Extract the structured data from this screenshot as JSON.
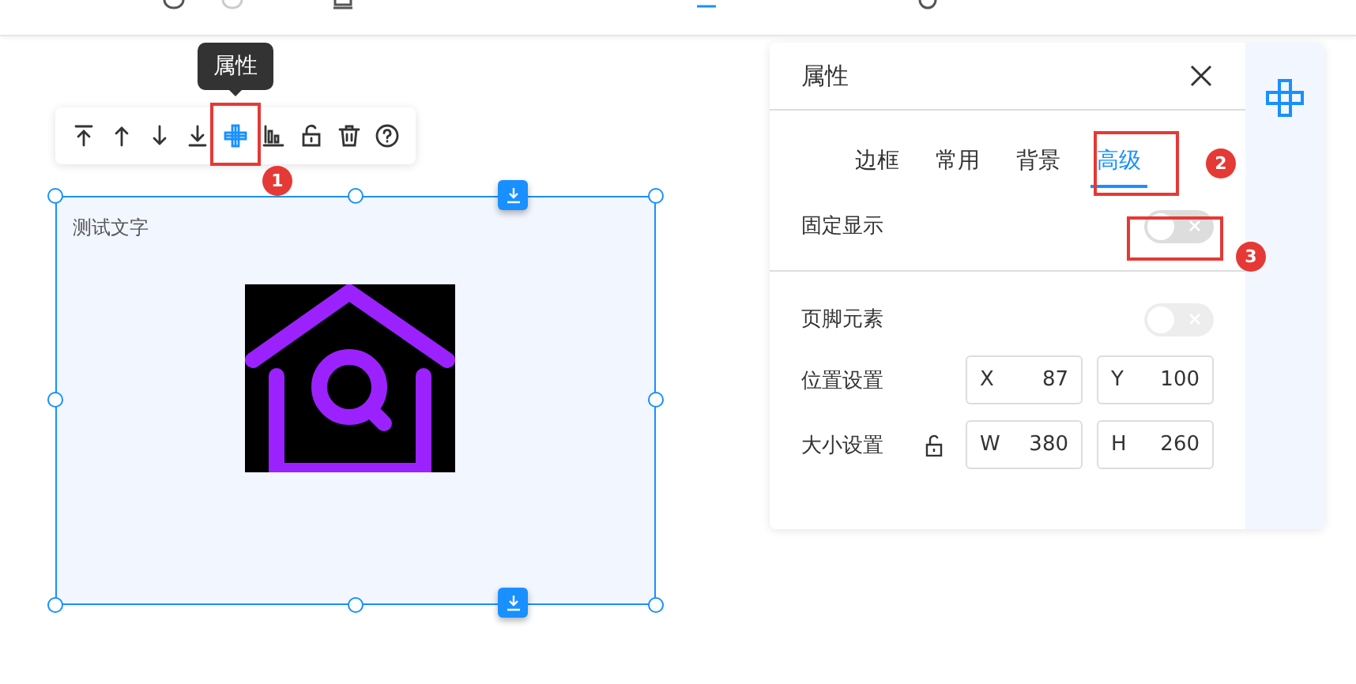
{
  "tooltip": {
    "text": "属性"
  },
  "element_toolbar": [
    {
      "kind": "top",
      "selected": false
    },
    {
      "kind": "up",
      "selected": false
    },
    {
      "kind": "down",
      "selected": false
    },
    {
      "kind": "bottom",
      "selected": false
    },
    {
      "kind": "props",
      "selected": true
    },
    {
      "kind": "align",
      "selected": false
    },
    {
      "kind": "lock",
      "selected": false
    },
    {
      "kind": "delete",
      "selected": false
    },
    {
      "kind": "help",
      "selected": false
    }
  ],
  "canvas_element": {
    "text": "测试文字"
  },
  "panel": {
    "title": "属性",
    "tabs": [
      {
        "label": "边框",
        "selected": false
      },
      {
        "label": "常用",
        "selected": false
      },
      {
        "label": "背景",
        "selected": false
      },
      {
        "label": "高级",
        "selected": true
      }
    ],
    "fixed_display": {
      "label": "固定显示",
      "on": false,
      "disabled": false
    },
    "footer_element": {
      "label": "页脚元素",
      "on": false,
      "disabled": true
    },
    "position": {
      "label": "位置设置",
      "fields": [
        {
          "prefix": "X",
          "value": "87"
        },
        {
          "prefix": "Y",
          "value": "100"
        }
      ]
    },
    "size": {
      "label": "大小设置",
      "locked": false,
      "fields": [
        {
          "prefix": "W",
          "value": "380"
        },
        {
          "prefix": "H",
          "value": "260"
        }
      ]
    }
  },
  "annotations": [
    {
      "number": "1"
    },
    {
      "number": "2"
    },
    {
      "number": "3"
    }
  ]
}
